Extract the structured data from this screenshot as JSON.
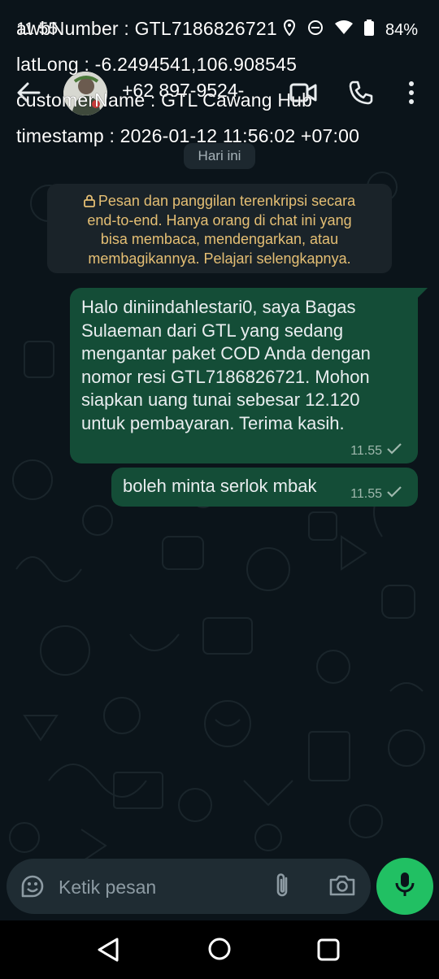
{
  "status_bar": {
    "time": "11.55",
    "battery_percent": "84%",
    "icons": [
      "location-icon",
      "do-not-disturb-icon",
      "wifi-icon",
      "battery-icon"
    ]
  },
  "watermark": {
    "awb_line": "awbNumber : GTL7186826721",
    "latlong_line": "latLong : -6.2494541,106.908545",
    "customer_line": "customerName : GTL Cawang Hub",
    "timestamp_line": "timestamp : 2026-01-12 11:56:02 +07:00"
  },
  "header": {
    "contact": "+62 897-9524-"
  },
  "date_chip": "Hari ini",
  "encryption_notice": {
    "lines": [
      "Pesan dan panggilan terenkripsi secara",
      "end-to-end. Hanya orang di chat ini yang",
      "bisa membaca, mendengarkan, atau",
      "membagikannya. Pelajari selengkapnya."
    ]
  },
  "messages": [
    {
      "lines": [
        "Halo diniindahlestari0, saya Bagas",
        "Sulaeman dari GTL yang sedang",
        "mengantar paket COD Anda dengan",
        "nomor resi GTL7186826721. Mohon",
        "siapkan uang tunai sebesar 12.120",
        "untuk pembayaran. Terima kasih."
      ],
      "time": "11.55",
      "status": "sent"
    },
    {
      "lines": [
        "boleh minta serlok mbak"
      ],
      "time": "11.55",
      "status": "sent"
    }
  ],
  "composer": {
    "placeholder": "Ketik pesan"
  },
  "colors": {
    "background": "#0b141a",
    "outgoing_bubble": "#144d37",
    "accent_green": "#21c063",
    "notice_text": "#e5bf74"
  }
}
